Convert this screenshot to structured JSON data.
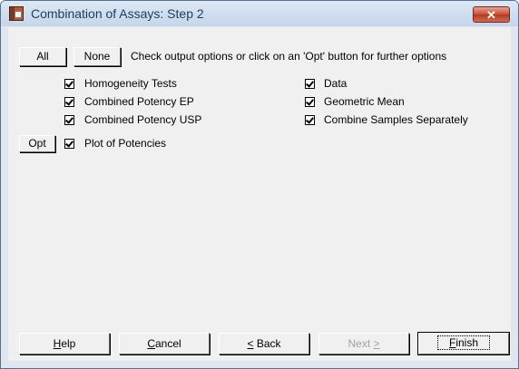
{
  "window": {
    "title": "Combination of Assays: Step 2",
    "close_label": "✕"
  },
  "toolbar": {
    "all_label": "All",
    "none_label": "None",
    "hint": "Check output options or click on an 'Opt' button for further options"
  },
  "options_left": [
    {
      "label": "Homogeneity Tests",
      "checked": true
    },
    {
      "label": "Combined Potency EP",
      "checked": true
    },
    {
      "label": "Combined Potency USP",
      "checked": true
    },
    {
      "label": "Plot of Potencies",
      "checked": true
    }
  ],
  "options_right": [
    {
      "label": "Data",
      "checked": true
    },
    {
      "label": "Geometric Mean",
      "checked": true
    },
    {
      "label": "Combine Samples Separately",
      "checked": true
    }
  ],
  "opt_button_label": "Opt",
  "footer": {
    "help_pre": "",
    "help_key": "H",
    "help_post": "elp",
    "cancel_pre": "",
    "cancel_key": "C",
    "cancel_post": "ancel",
    "back_pre": "",
    "back_key": "<",
    "back_post": " Back",
    "next_pre": "Next ",
    "next_key": ">",
    "next_post": "",
    "finish_pre": "",
    "finish_key": "F",
    "finish_post": "inish",
    "next_disabled": true
  }
}
